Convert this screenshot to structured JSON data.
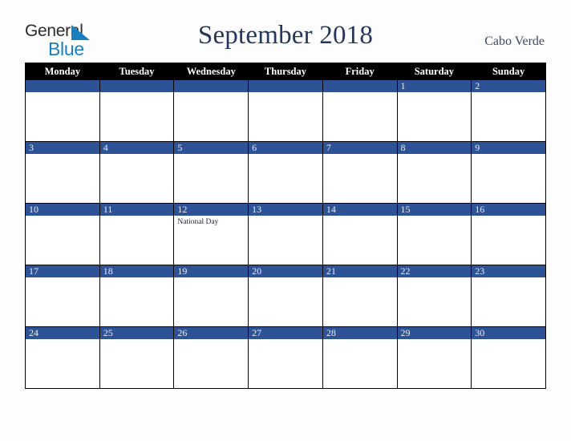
{
  "brand": {
    "word_one": "General",
    "word_two": "Blue",
    "triangle_icon": "triangle-icon",
    "accent_blue": "#1a7fc1",
    "text_dark": "#2b2b2b"
  },
  "header": {
    "title": "September 2018",
    "country": "Cabo Verde",
    "title_color": "#26375e"
  },
  "calendar": {
    "weekday_headers": [
      "Monday",
      "Tuesday",
      "Wednesday",
      "Thursday",
      "Friday",
      "Saturday",
      "Sunday"
    ],
    "header_bg": "#000000",
    "header_text": "#ffffff",
    "date_bar_bg": "#2d5295",
    "date_bar_text": "#e8edf5",
    "cell_bg": "#ffffff",
    "border_color": "#000000",
    "weeks": [
      [
        {
          "day": "",
          "events": []
        },
        {
          "day": "",
          "events": []
        },
        {
          "day": "",
          "events": []
        },
        {
          "day": "",
          "events": []
        },
        {
          "day": "",
          "events": []
        },
        {
          "day": "1",
          "events": []
        },
        {
          "day": "2",
          "events": []
        }
      ],
      [
        {
          "day": "3",
          "events": []
        },
        {
          "day": "4",
          "events": []
        },
        {
          "day": "5",
          "events": []
        },
        {
          "day": "6",
          "events": []
        },
        {
          "day": "7",
          "events": []
        },
        {
          "day": "8",
          "events": []
        },
        {
          "day": "9",
          "events": []
        }
      ],
      [
        {
          "day": "10",
          "events": []
        },
        {
          "day": "11",
          "events": []
        },
        {
          "day": "12",
          "events": [
            "National Day"
          ]
        },
        {
          "day": "13",
          "events": []
        },
        {
          "day": "14",
          "events": []
        },
        {
          "day": "15",
          "events": []
        },
        {
          "day": "16",
          "events": []
        }
      ],
      [
        {
          "day": "17",
          "events": []
        },
        {
          "day": "18",
          "events": []
        },
        {
          "day": "19",
          "events": []
        },
        {
          "day": "20",
          "events": []
        },
        {
          "day": "21",
          "events": []
        },
        {
          "day": "22",
          "events": []
        },
        {
          "day": "23",
          "events": []
        }
      ],
      [
        {
          "day": "24",
          "events": []
        },
        {
          "day": "25",
          "events": []
        },
        {
          "day": "26",
          "events": []
        },
        {
          "day": "27",
          "events": []
        },
        {
          "day": "28",
          "events": []
        },
        {
          "day": "29",
          "events": []
        },
        {
          "day": "30",
          "events": []
        }
      ]
    ]
  }
}
